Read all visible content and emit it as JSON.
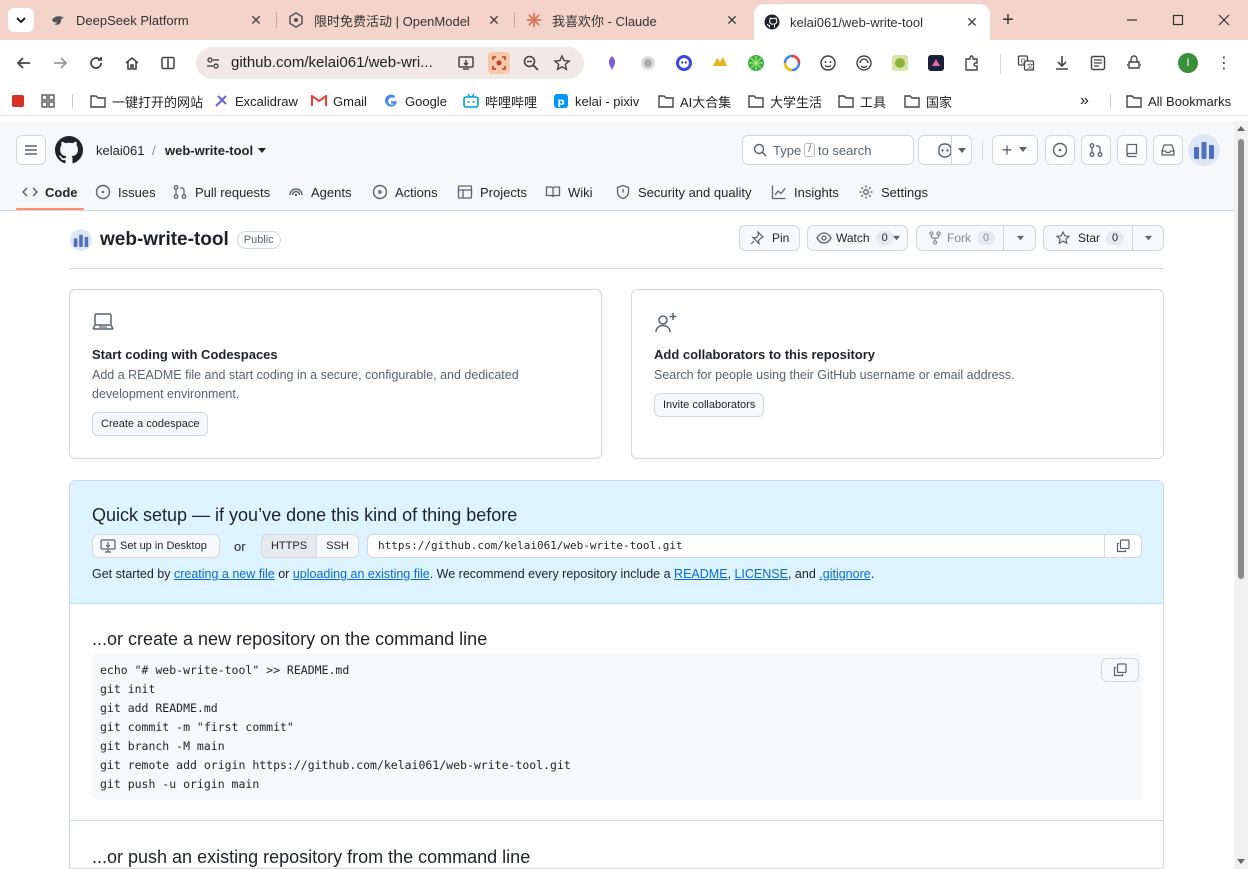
{
  "browser": {
    "tabs": [
      {
        "title": "DeepSeek Platform"
      },
      {
        "title": "限时免费活动 | OpenModel"
      },
      {
        "title": "我喜欢你 - Claude"
      },
      {
        "title": "kelai061/web-write-tool"
      }
    ],
    "url": "github.com/kelai061/web-wri...",
    "profile_initial": "I",
    "bookmarks": [
      {
        "label": "一键打开的网站"
      },
      {
        "label": "Excalidraw"
      },
      {
        "label": "Gmail"
      },
      {
        "label": "Google"
      },
      {
        "label": "哔哩哔哩"
      },
      {
        "label": "kelai - pixiv"
      },
      {
        "label": "AI大合集"
      },
      {
        "label": "大学生活"
      },
      {
        "label": "工具"
      },
      {
        "label": "国家"
      }
    ],
    "bookmarks_more": "»",
    "all_bookmarks": "All Bookmarks"
  },
  "github": {
    "owner": "kelai061",
    "sep": "/",
    "repo": "web-write-tool",
    "search_prefix": "Type",
    "search_key": "/",
    "search_suffix": "to search",
    "nav": [
      {
        "label": "Code"
      },
      {
        "label": "Issues"
      },
      {
        "label": "Pull requests"
      },
      {
        "label": "Agents"
      },
      {
        "label": "Actions"
      },
      {
        "label": "Projects"
      },
      {
        "label": "Wiki"
      },
      {
        "label": "Security and quality"
      },
      {
        "label": "Insights"
      },
      {
        "label": "Settings"
      }
    ]
  },
  "repo": {
    "name": "web-write-tool",
    "visibility": "Public",
    "pin_label": "Pin",
    "watch_label": "Watch",
    "watch_count": "0",
    "fork_label": "Fork",
    "fork_count": "0",
    "star_label": "Star",
    "star_count": "0"
  },
  "codespaces_card": {
    "title": "Start coding with Codespaces",
    "desc_line1": "Add a README file and start coding in a secure, configurable, and dedicated",
    "desc_line2": "development environment.",
    "button": "Create a codespace"
  },
  "collab_card": {
    "title": "Add collaborators to this repository",
    "desc": "Search for people using their GitHub username or email address.",
    "button": "Invite collaborators"
  },
  "quick_setup": {
    "title": "Quick setup — if you’ve done this kind of thing before",
    "desktop_button": "Set up in Desktop",
    "or": "or",
    "https": "HTTPS",
    "ssh": "SSH",
    "clone_url": "https://github.com/kelai061/web-write-tool.git",
    "help_1": "Get started by ",
    "link_new_file": "creating a new file",
    "help_2": " or ",
    "link_upload": "uploading an existing file",
    "help_3": ". We recommend every repository include a ",
    "link_readme": "README",
    "help_4": ", ",
    "link_license": "LICENSE",
    "help_5": ", and ",
    "link_gitignore": ".gitignore",
    "help_6": "."
  },
  "new_repo": {
    "title": "...or create a new repository on the command line",
    "lines": [
      "echo \"# web-write-tool\" >> README.md",
      "git init",
      "git add README.md",
      "git commit -m \"first commit\"",
      "git branch -M main",
      "git remote add origin https://github.com/kelai061/web-write-tool.git",
      "git push -u origin main"
    ]
  },
  "push_existing": {
    "title": "...or push an existing repository from the command line"
  },
  "colors": {
    "accent_underline": "#fd8c73",
    "link": "#0969da",
    "quick_bg": "#ddf4ff"
  }
}
